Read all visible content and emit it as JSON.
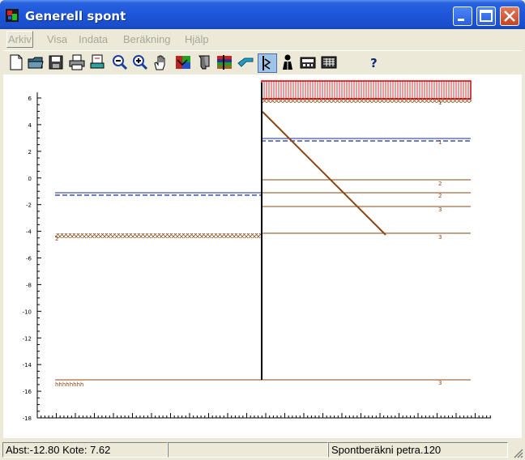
{
  "window": {
    "title": "Generell spont"
  },
  "menu": [
    "Arkiv",
    "Visa",
    "Indata",
    "Beräkning",
    "Hjälp"
  ],
  "toolbar_icons": [
    "new-file-icon",
    "open-folder-icon",
    "save-icon",
    "print-icon",
    "print-preview-icon",
    "zoom-out-icon",
    "zoom-in-icon",
    "pan-hand-icon",
    "layers-icon",
    "sheet-pile-icon",
    "soil-layers-icon",
    "anchor-icon",
    "sheet-pile-check-icon",
    "person-icon",
    "calculator-icon",
    "table-icon",
    "help-icon"
  ],
  "chart": {
    "y_ticks": [
      "6",
      "4",
      "2",
      "0",
      "-2",
      "-4",
      "-6",
      "-8",
      "-10",
      "-12",
      "-14",
      "-16",
      "-18"
    ],
    "right_labels": [
      "1",
      "1",
      "2",
      "2",
      "3",
      "3",
      "3"
    ],
    "left_label": "2",
    "bottom_left_label": "hhhhhhhh",
    "colors": {
      "wall": "#000000",
      "soil": "#8b4513",
      "water": "#1a2e99",
      "load": "#cc0000",
      "axis": "#000000"
    }
  },
  "status": {
    "coords": "Abst:-12.80  Kote:  7.62",
    "middle": "",
    "file": "Spontberäkni petra.120"
  }
}
